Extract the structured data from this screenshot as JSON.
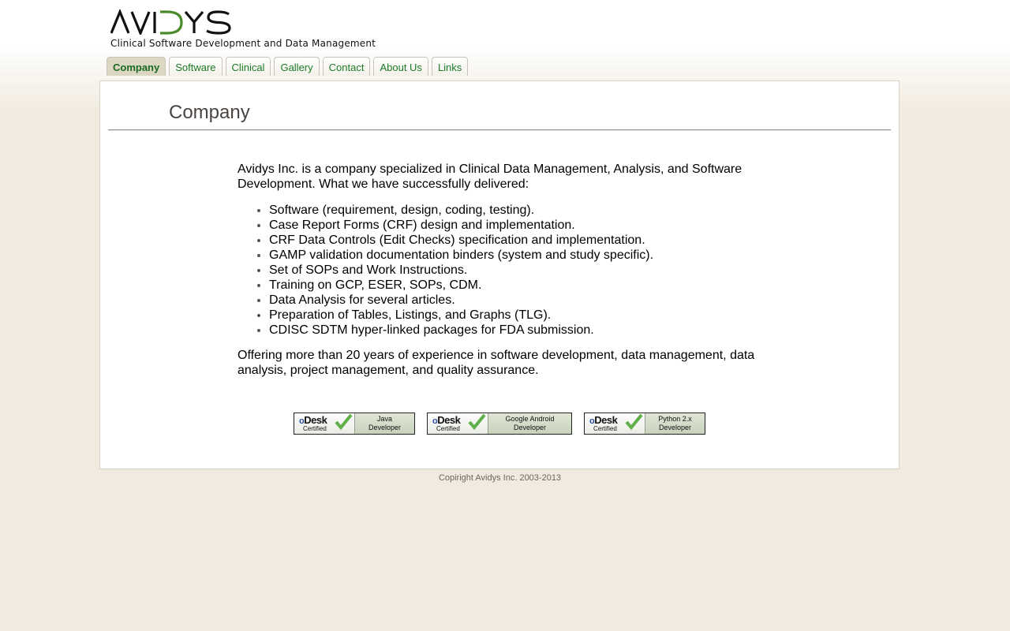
{
  "brand": {
    "logo_text": "AVIDYS",
    "tagline": "Clinical Software Development and Data Management"
  },
  "tabs": [
    {
      "label": "Company",
      "active": true
    },
    {
      "label": "Software",
      "active": false
    },
    {
      "label": "Clinical",
      "active": false
    },
    {
      "label": "Gallery",
      "active": false
    },
    {
      "label": "Contact",
      "active": false
    },
    {
      "label": "About Us",
      "active": false
    },
    {
      "label": "Links",
      "active": false
    }
  ],
  "page": {
    "title": "Company",
    "intro": "Avidys Inc. is a company specialized in Clinical Data Management, Analysis, and Software Development. What we have successfully delivered:",
    "items": [
      "Software (requirement, design, coding, testing).",
      "Case Report Forms (CRF) design and implementation.",
      "CRF Data Controls (Edit Checks) specification and implementation.",
      "GAMP validation documentation binders (system and study specific).",
      "Set of SOPs and Work Instructions.",
      "Training on GCP, ESER, SOPs, CDM.",
      "Data Analysis for several articles.",
      "Preparation of Tables, Listings, and Graphs (TLG).",
      "CDISC SDTM hyper-linked packages for FDA submission."
    ],
    "outro": "Offering more than 20 years of experience in software development, data management, data analysis, project management, and quality assurance."
  },
  "badges": [
    {
      "brand": "Desk",
      "brand_prefix": "o",
      "certified": "Certified",
      "line1": "Java",
      "line2": "Developer"
    },
    {
      "brand": "Desk",
      "brand_prefix": "o",
      "certified": "Certified",
      "line1": "Google Android",
      "line2": "Developer"
    },
    {
      "brand": "Desk",
      "brand_prefix": "o",
      "certified": "Certified",
      "line1": "Python 2.x",
      "line2": "Developer"
    }
  ],
  "footer": {
    "copyright": "Copiright Avidys Inc. 2003-2013"
  },
  "colors": {
    "link_green": "#1b7a25",
    "logo_green": "#4a8a2a",
    "background": "#f1eadf"
  }
}
